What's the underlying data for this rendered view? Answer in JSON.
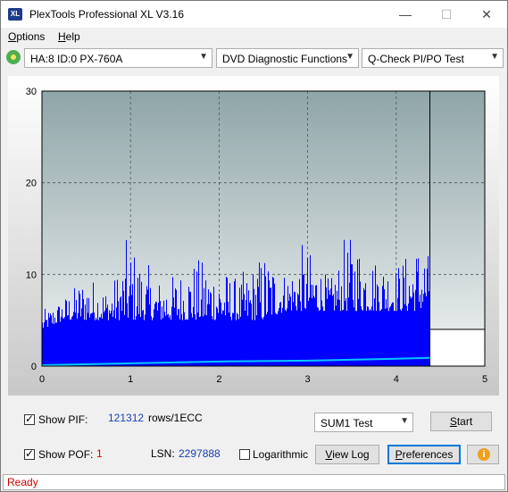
{
  "window": {
    "title": "PlexTools Professional XL V3.16",
    "app_icon_text": "XL",
    "min_glyph": "—",
    "max_glyph": "☐",
    "close_glyph": "✕"
  },
  "menu": {
    "options": "Options",
    "help": "Help"
  },
  "toolbar": {
    "drive": "HA:8 ID:0  PX-760A",
    "function": "DVD Diagnostic Functions",
    "test": "Q-Check PI/PO Test"
  },
  "chart_data": {
    "type": "bar",
    "xlim": [
      0,
      5
    ],
    "ylim": [
      0,
      30
    ],
    "x_ticks": [
      "0",
      "1",
      "2",
      "3",
      "4",
      "5"
    ],
    "y_ticks": [
      "0",
      "10",
      "20",
      "30"
    ],
    "grid": true,
    "data_end_x": 4.38,
    "marker_line_x": 4.38,
    "series": [
      {
        "color": "#0000ff",
        "x": [
          0.0,
          0.25,
          0.5,
          0.75,
          1.0,
          1.25,
          1.5,
          1.75,
          2.0,
          2.25,
          2.5,
          2.75,
          3.0,
          3.25,
          3.5,
          3.75,
          4.0,
          4.25,
          4.38
        ],
        "baseline": [
          4,
          5,
          5,
          5,
          5,
          5,
          5,
          5,
          5,
          5,
          5,
          6,
          6,
          6,
          6,
          6,
          6,
          6,
          7
        ],
        "peaks": [
          6,
          8,
          11,
          9,
          15,
          10,
          11,
          13,
          12,
          10,
          14,
          11,
          14,
          10,
          16,
          13,
          12,
          15,
          13
        ]
      },
      {
        "color": "#00c8ff",
        "x": [
          0.0,
          1.0,
          2.0,
          3.0,
          4.0,
          4.38
        ],
        "values": [
          0.1,
          0.3,
          0.5,
          0.6,
          0.8,
          0.9
        ]
      }
    ],
    "after_level": 4,
    "colors": {
      "plot_bg_top": "#8fa5a8",
      "plot_bg_bottom": "#f2f4f4",
      "grid": "#4a5a5a"
    }
  },
  "controls": {
    "show_pif_label": "Show PIF:",
    "pif_value": "121312",
    "rows_label": "rows/1ECC",
    "show_pof_label": "Show POF:",
    "pof_value": "1",
    "lsn_label": "LSN:",
    "lsn_value": "2297888",
    "logarithmic_label": "Logarithmic",
    "sum_select": "SUM1 Test",
    "start_button": "Start",
    "view_log_button": "View Log",
    "preferences_button": "Preferences",
    "info_glyph": "i"
  },
  "status": {
    "text": "Ready"
  }
}
